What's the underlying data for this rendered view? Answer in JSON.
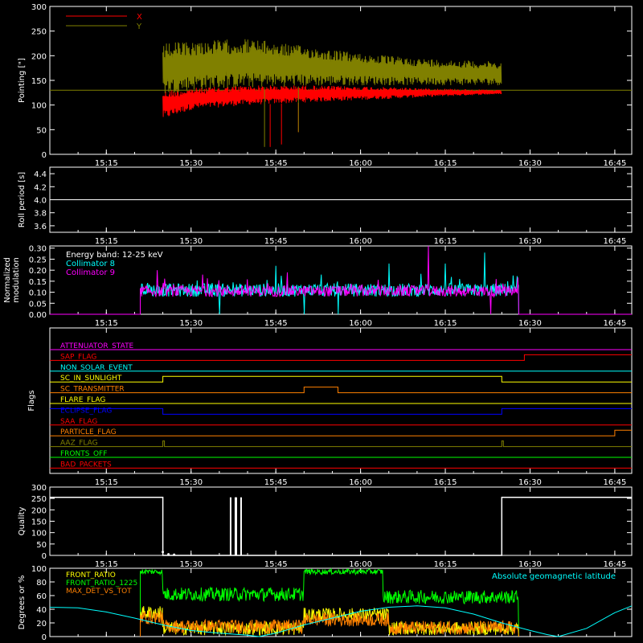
{
  "figure": {
    "background": "#000000",
    "axis_color": "#ffffff"
  },
  "time_axis": {
    "range": [
      "15:05",
      "16:48"
    ],
    "tick_labels": [
      "15:15",
      "15:30",
      "15:45",
      "16:00",
      "16:15",
      "16:30",
      "16:45"
    ],
    "tick_values": [
      "15:15",
      "15:30",
      "15:45",
      "16:00",
      "16:15",
      "16:30",
      "16:45"
    ]
  },
  "chart_data": [
    {
      "id": "pointing",
      "type": "line",
      "ylabel": "Pointing [\"]",
      "ylim": [
        0,
        300
      ],
      "yticks": [
        0,
        50,
        100,
        150,
        200,
        250,
        300
      ],
      "legend_position": "top-left",
      "reference_value": 130,
      "series": [
        {
          "name": "X",
          "color": "#ff0000",
          "start": "15:25",
          "end": "16:25",
          "envelope_points": [
            [
              "15:25",
              70,
              130
            ],
            [
              "15:30",
              90,
              135
            ],
            [
              "15:40",
              100,
              140
            ],
            [
              "15:50",
              105,
              140
            ],
            [
              "16:00",
              110,
              138
            ],
            [
              "16:10",
              115,
              135
            ],
            [
              "16:20",
              120,
              132
            ],
            [
              "16:25",
              122,
              130
            ]
          ],
          "spikes": [
            [
              "15:44",
              15
            ],
            [
              "15:46",
              20
            ],
            [
              "15:49",
              45
            ]
          ]
        },
        {
          "name": "Y",
          "color": "#808000",
          "start": "15:25",
          "end": "16:25",
          "envelope_points": [
            [
              "15:25",
              120,
              225
            ],
            [
              "15:30",
              130,
              230
            ],
            [
              "15:40",
              135,
              235
            ],
            [
              "15:50",
              138,
              220
            ],
            [
              "16:00",
              140,
              205
            ],
            [
              "16:10",
              140,
              195
            ],
            [
              "16:20",
              140,
              190
            ],
            [
              "16:25",
              140,
              188
            ]
          ],
          "spikes": [
            [
              "15:43",
              15
            ],
            [
              "15:49",
              45
            ]
          ]
        }
      ]
    },
    {
      "id": "roll-period",
      "type": "line",
      "ylabel": "Roll period [s]",
      "ylim": [
        3.5,
        4.5
      ],
      "yticks": [
        3.6,
        3.8,
        4.0,
        4.2,
        4.4
      ],
      "series": [
        {
          "color": "#ffffff",
          "values": [
            [
              "15:05",
              4.0
            ],
            [
              "16:48",
              4.0
            ]
          ]
        }
      ]
    },
    {
      "id": "modulation",
      "type": "line",
      "ylabel": [
        "Normalized",
        "modulation"
      ],
      "ylim": [
        0,
        0.31
      ],
      "yticks": [
        0.0,
        0.05,
        0.1,
        0.15,
        0.2,
        0.25,
        0.3
      ],
      "ytick_labels": [
        "0.00",
        "0.05",
        "0.10",
        "0.15",
        "0.20",
        "0.25",
        "0.30"
      ],
      "legend": [
        "Energy band: 12-25 keV",
        "Collimator 8",
        "Collimator 9"
      ],
      "legend_colors": [
        "#ffffff",
        "#00ffff",
        "#ff00ff"
      ],
      "legend_position": "top-left",
      "series": [
        {
          "name": "Collimator 8",
          "color": "#00ffff",
          "start": "15:21",
          "end": "16:28",
          "base_range": [
            0.08,
            0.14
          ],
          "spikes": [
            [
              "15:35",
              0.27
            ],
            [
              "15:45",
              0.22
            ],
            [
              "15:53",
              0.18
            ],
            [
              "16:05",
              0.23
            ],
            [
              "16:15",
              0.23
            ],
            [
              "16:22",
              0.28
            ],
            [
              "16:26",
              0.15
            ]
          ],
          "dips": [
            "15:35",
            "15:50",
            "15:56"
          ]
        },
        {
          "name": "Collimator 9",
          "color": "#ff00ff",
          "start": "15:21",
          "end": "16:28",
          "base_range": [
            0.08,
            0.13
          ],
          "spikes": [
            [
              "15:24",
              0.2
            ],
            [
              "15:32",
              0.18
            ],
            [
              "15:47",
              0.19
            ],
            [
              "16:12",
              0.31
            ],
            [
              "16:23",
              0.31
            ],
            [
              "16:24",
              0.16
            ]
          ],
          "dips": [
            "16:23"
          ]
        }
      ]
    },
    {
      "id": "flags",
      "type": "line",
      "ylabel": "Flags",
      "series": [
        {
          "name": "ATTENUATOR_STATE",
          "color": "#ff00ff",
          "states": [
            [
              "15:05",
              0
            ]
          ]
        },
        {
          "name": "SAP_FLAG",
          "color": "#ff0000",
          "states": [
            [
              "15:05",
              0
            ],
            [
              "16:29",
              1
            ]
          ]
        },
        {
          "name": "NON_SOLAR_EVENT",
          "color": "#00ffff",
          "states": [
            [
              "15:05",
              0
            ]
          ]
        },
        {
          "name": "SC_IN_SUNLIGHT",
          "color": "#ffff00",
          "states": [
            [
              "15:05",
              0
            ],
            [
              "15:25",
              1
            ],
            [
              "16:25",
              0
            ]
          ]
        },
        {
          "name": "SC_TRANSMITTER",
          "color": "#ff8000",
          "states": [
            [
              "15:05",
              0
            ],
            [
              "15:50",
              1
            ],
            [
              "15:56",
              0
            ]
          ]
        },
        {
          "name": "FLARE_FLAG",
          "color": "#ffff00",
          "states": [
            [
              "15:05",
              0
            ]
          ]
        },
        {
          "name": "ECLIPSE_FLAG",
          "color": "#0000ff",
          "states": [
            [
              "15:05",
              1
            ],
            [
              "15:25",
              0
            ],
            [
              "16:25",
              1
            ]
          ]
        },
        {
          "name": "SAA_FLAG",
          "color": "#ff0000",
          "states": [
            [
              "15:05",
              0
            ]
          ]
        },
        {
          "name": "PARTICLE_FLAG",
          "color": "#ff8000",
          "states": [
            [
              "15:05",
              0
            ],
            [
              "16:45",
              1
            ]
          ]
        },
        {
          "name": "AAZ_FLAG",
          "color": "#808000",
          "pulses": [
            "15:25",
            "16:25"
          ]
        },
        {
          "name": "FRONTS_OFF",
          "color": "#00ff00",
          "states": [
            [
              "15:05",
              0
            ]
          ]
        },
        {
          "name": "BAD_PACKETS",
          "color": "#ff0000",
          "states": [
            [
              "15:05",
              0
            ]
          ]
        }
      ]
    },
    {
      "id": "quality",
      "type": "line",
      "ylabel": "Quality",
      "ylim": [
        0,
        300
      ],
      "yticks": [
        0,
        50,
        100,
        150,
        200,
        250,
        300
      ],
      "series": [
        {
          "color": "#ffffff",
          "values": [
            [
              "15:05",
              255
            ],
            [
              "15:25",
              255
            ],
            [
              "15:25",
              0
            ],
            [
              "16:25",
              0
            ],
            [
              "16:25",
              255
            ],
            [
              "16:48",
              255
            ]
          ],
          "spikes": [
            [
              "15:37",
              255
            ],
            [
              "15:38",
              255
            ]
          ],
          "dots": [
            [
              "15:25",
              15
            ],
            [
              "15:26",
              5
            ],
            [
              "15:27",
              3
            ]
          ]
        }
      ]
    },
    {
      "id": "ratios",
      "type": "line",
      "ylabel": "Degrees or %",
      "ylim": [
        0,
        100
      ],
      "yticks": [
        0,
        20,
        40,
        60,
        80,
        100
      ],
      "legend": [
        "FRONT_RATIO",
        "FRONT_RATIO_1225",
        "MAX_DET_VS_TOT"
      ],
      "legend_colors": [
        "#ffff00",
        "#00ff00",
        "#ff8000"
      ],
      "legend_position": "top-left",
      "right_legend": "Absolute geomagnetic latitude",
      "right_legend_color": "#00ffff",
      "series": [
        {
          "name": "FRONT_RATIO_1225",
          "color": "#00ff00",
          "start": "15:21",
          "end": "16:28",
          "levels": [
            [
              "15:21",
              "15:25",
              95
            ],
            [
              "15:25",
              "15:50",
              62
            ],
            [
              "15:50",
              "16:04",
              95
            ],
            [
              "16:04",
              "16:28",
              58
            ]
          ]
        },
        {
          "name": "FRONT_RATIO",
          "color": "#ffff00",
          "start": "15:21",
          "end": "16:28",
          "levels": [
            [
              "15:21",
              "15:25",
              35
            ],
            [
              "15:25",
              "15:50",
              12
            ],
            [
              "15:50",
              "16:05",
              32
            ],
            [
              "16:05",
              "16:28",
              12
            ]
          ]
        },
        {
          "name": "MAX_DET_VS_TOT",
          "color": "#ff8000",
          "start": "15:21",
          "end": "16:28",
          "levels": [
            [
              "15:21",
              "15:25",
              28
            ],
            [
              "15:25",
              "15:50",
              15
            ],
            [
              "15:50",
              "16:05",
              25
            ],
            [
              "16:05",
              "16:28",
              13
            ]
          ]
        },
        {
          "name": "Absolute geomagnetic latitude",
          "color": "#00ffff",
          "values": [
            [
              "15:05",
              43
            ],
            [
              "15:10",
              42
            ],
            [
              "15:15",
              36
            ],
            [
              "15:20",
              27
            ],
            [
              "15:25",
              17
            ],
            [
              "15:30",
              9
            ],
            [
              "15:35",
              5
            ],
            [
              "15:40",
              2
            ],
            [
              "15:42",
              0
            ],
            [
              "15:45",
              5
            ],
            [
              "15:50",
              17
            ],
            [
              "15:55",
              27
            ],
            [
              "16:00",
              37
            ],
            [
              "16:05",
              43
            ],
            [
              "16:10",
              45
            ],
            [
              "16:15",
              42
            ],
            [
              "16:20",
              33
            ],
            [
              "16:25",
              20
            ],
            [
              "16:30",
              9
            ],
            [
              "16:33",
              3
            ],
            [
              "16:35",
              0
            ],
            [
              "16:40",
              12
            ],
            [
              "16:45",
              35
            ],
            [
              "16:48",
              45
            ]
          ]
        }
      ]
    }
  ]
}
